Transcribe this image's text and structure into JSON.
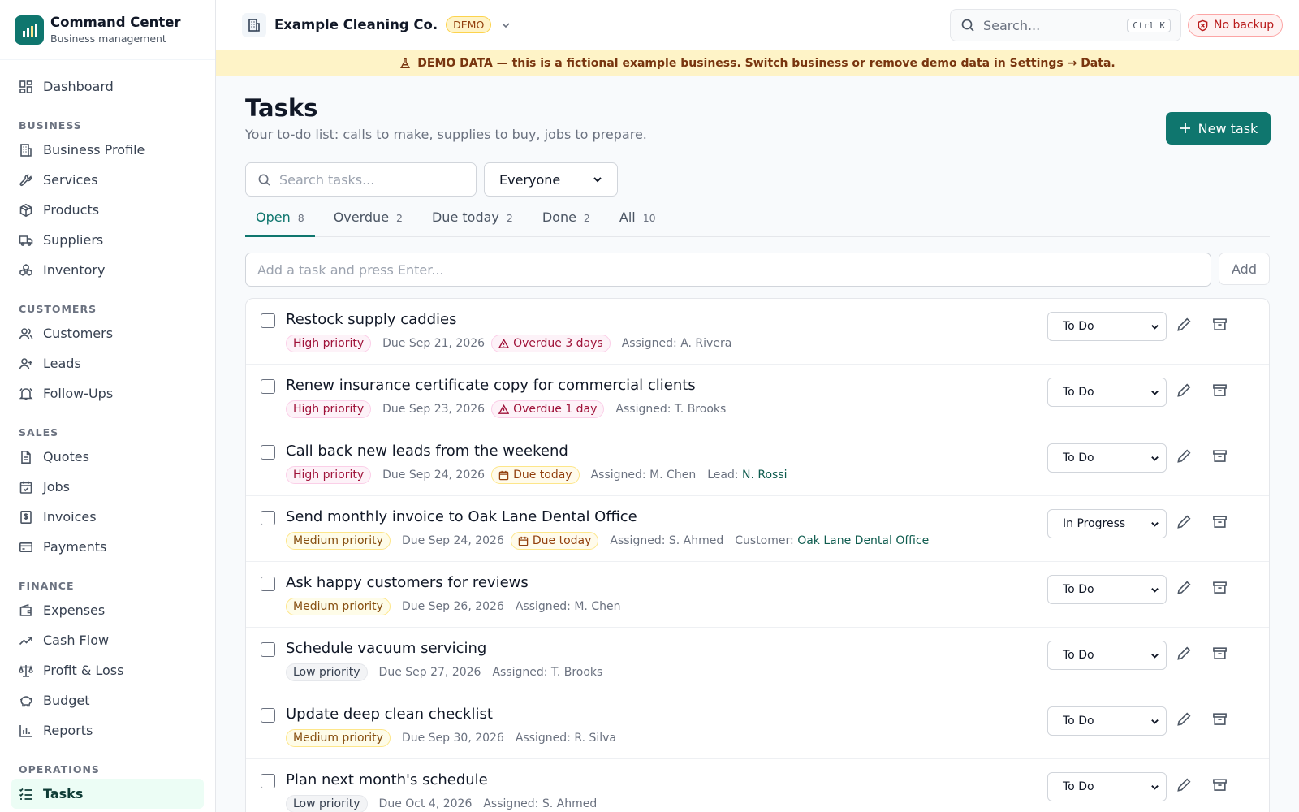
{
  "app": {
    "title": "Command Center",
    "subtitle": "Business management"
  },
  "sidebar": {
    "dashboard": "Dashboard",
    "sections": {
      "business": "BUSINESS",
      "customers": "CUSTOMERS",
      "sales": "SALES",
      "finance": "FINANCE",
      "operations": "OPERATIONS"
    },
    "business_items": [
      "Business Profile",
      "Services",
      "Products",
      "Suppliers",
      "Inventory"
    ],
    "customer_items": [
      "Customers",
      "Leads",
      "Follow-Ups"
    ],
    "sales_items": [
      "Quotes",
      "Jobs",
      "Invoices",
      "Payments"
    ],
    "finance_items": [
      "Expenses",
      "Cash Flow",
      "Profit & Loss",
      "Budget",
      "Reports"
    ],
    "operations_items": [
      "Tasks"
    ]
  },
  "topbar": {
    "business_name": "Example Cleaning Co.",
    "badge": "DEMO",
    "search_placeholder": "Search...",
    "shortcut": "Ctrl K",
    "backup_status": "No backup"
  },
  "banner": {
    "text": "DEMO DATA — this is a fictional example business. Switch business or remove demo data in Settings → Data."
  },
  "page": {
    "title": "Tasks",
    "subtitle": "Your to-do list: calls to make, supplies to buy, jobs to prepare.",
    "new_task": "New task",
    "search_placeholder": "Search tasks...",
    "assignee_filter": "Everyone",
    "add_placeholder": "Add a task and press Enter...",
    "add_button": "Add"
  },
  "tabs": [
    {
      "label": "Open",
      "count": "8"
    },
    {
      "label": "Overdue",
      "count": "2"
    },
    {
      "label": "Due today",
      "count": "2"
    },
    {
      "label": "Done",
      "count": "2"
    },
    {
      "label": "All",
      "count": "10"
    }
  ],
  "tasks": [
    {
      "title": "Restock supply caddies",
      "priority": "High priority",
      "due": "Due Sep 21, 2026",
      "flag": "Overdue 3 days",
      "assigned": "Assigned: A. Rivera",
      "status": "To Do"
    },
    {
      "title": "Renew insurance certificate copy for commercial clients",
      "priority": "High priority",
      "due": "Due Sep 23, 2026",
      "flag": "Overdue 1 day",
      "assigned": "Assigned: T. Brooks",
      "status": "To Do"
    },
    {
      "title": "Call back new leads from the weekend",
      "priority": "High priority",
      "due": "Due Sep 24, 2026",
      "flag": "Due today",
      "assigned": "Assigned: M. Chen",
      "rel_label": "Lead:",
      "rel_value": "N. Rossi",
      "status": "To Do"
    },
    {
      "title": "Send monthly invoice to Oak Lane Dental Office",
      "priority": "Medium priority",
      "due": "Due Sep 24, 2026",
      "flag": "Due today",
      "assigned": "Assigned: S. Ahmed",
      "rel_label": "Customer:",
      "rel_value": "Oak Lane Dental Office",
      "status": "In Progress"
    },
    {
      "title": "Ask happy customers for reviews",
      "priority": "Medium priority",
      "due": "Due Sep 26, 2026",
      "assigned": "Assigned: M. Chen",
      "status": "To Do"
    },
    {
      "title": "Schedule vacuum servicing",
      "priority": "Low priority",
      "due": "Due Sep 27, 2026",
      "assigned": "Assigned: T. Brooks",
      "status": "To Do"
    },
    {
      "title": "Update deep clean checklist",
      "priority": "Medium priority",
      "due": "Due Sep 30, 2026",
      "assigned": "Assigned: R. Silva",
      "status": "To Do"
    },
    {
      "title": "Plan next month's schedule",
      "priority": "Low priority",
      "due": "Due Oct 4, 2026",
      "assigned": "Assigned: S. Ahmed",
      "status": "To Do"
    }
  ],
  "colors": {
    "brand": "#0f766e",
    "danger": "#b91c1c",
    "warning_bg": "#fef3c7"
  }
}
